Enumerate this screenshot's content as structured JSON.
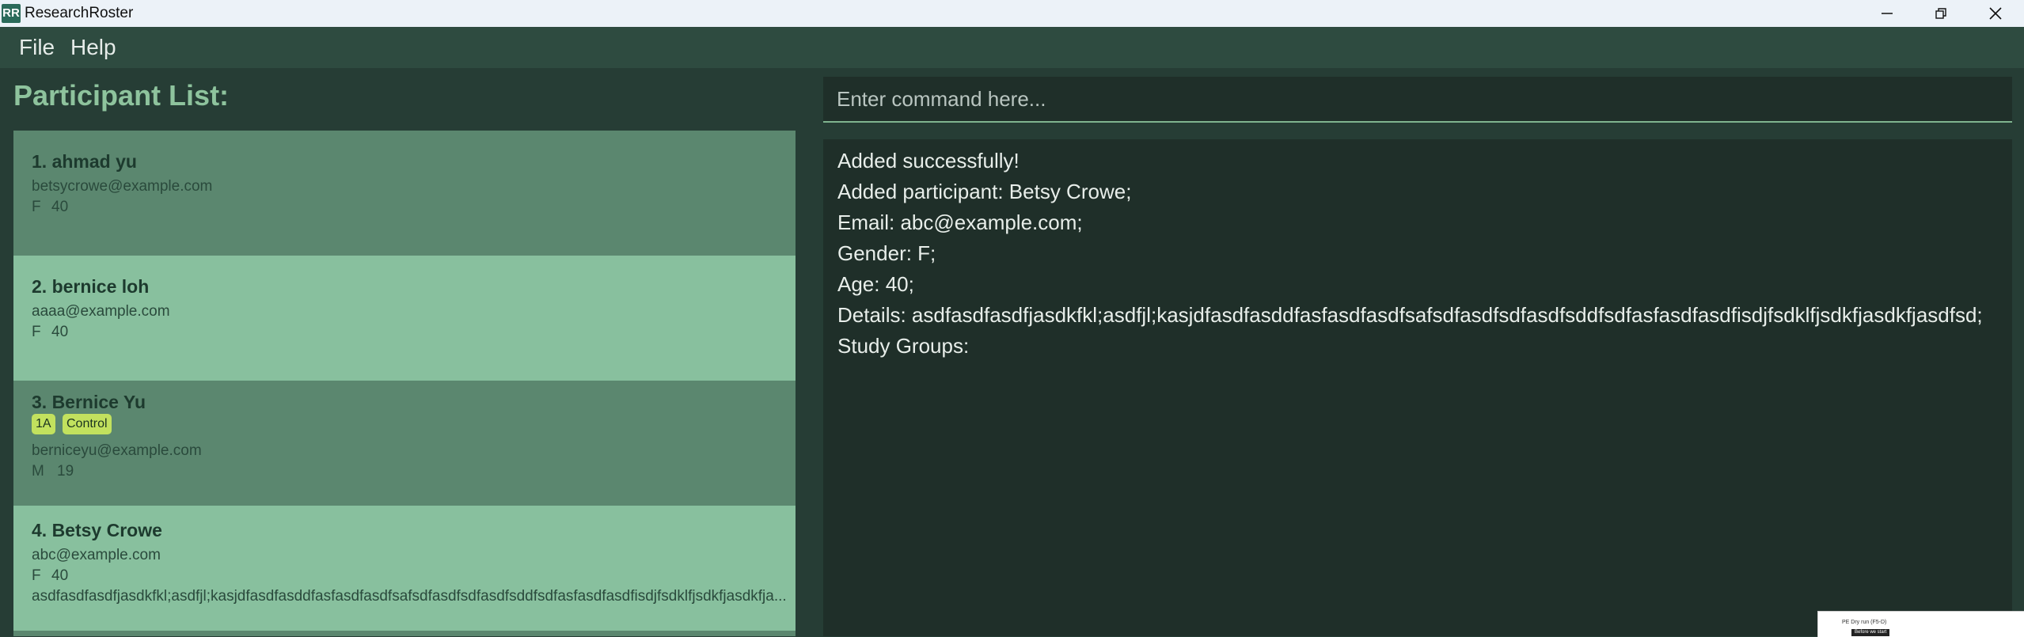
{
  "window": {
    "title": "ResearchRoster",
    "logo": "RR"
  },
  "menu": {
    "file": "File",
    "help": "Help"
  },
  "list_title": "Participant List:",
  "participants": [
    {
      "name": "1. ahmad yu",
      "tags": [],
      "email": "betsycrowe@example.com",
      "gender": "F",
      "age": "40",
      "details": ""
    },
    {
      "name": "2. bernice loh",
      "tags": [],
      "email": "aaaa@example.com",
      "gender": "F",
      "age": "40",
      "details": ""
    },
    {
      "name": "3. Bernice Yu",
      "tags": [
        "1A",
        "Control"
      ],
      "email": "berniceyu@example.com",
      "gender": "M",
      "age": "19",
      "details": ""
    },
    {
      "name": "4. Betsy Crowe",
      "tags": [],
      "email": "abc@example.com",
      "gender": "F",
      "age": "40",
      "details": "asdfasdfasdfjasdkfkl;asdfjl;kasjdfasdfasddfasfasdfasdfsafsdfasdfsdfasdfsddfsdfasfasdfasdfisdjfsdklfjsdkfjasdkfja..."
    }
  ],
  "command": {
    "placeholder": "Enter command here...",
    "value": ""
  },
  "result_lines": [
    "Added successfully!",
    "Added participant: Betsy Crowe;",
    " Email: abc@example.com;",
    " Gender: F;",
    " Age: 40;",
    " Details: asdfasdfasdfjasdkfkl;asdfjl;kasjdfasdfasddfasfasdfasdfsafsdfasdfsdfasdfsddfsdfasfasdfasdfisdjfsdklfjsdkfjasdkfjasdfsd;",
    " Study Groups:"
  ],
  "taskbar_thumb": {
    "title": "PE Dry run (F5-D)",
    "button": "Before we start"
  },
  "colors": {
    "card_dark": "#5b876f",
    "card_light": "#88c09e",
    "tag": "#c2e15e",
    "background": "#263d35",
    "accent": "#8ec39d"
  }
}
